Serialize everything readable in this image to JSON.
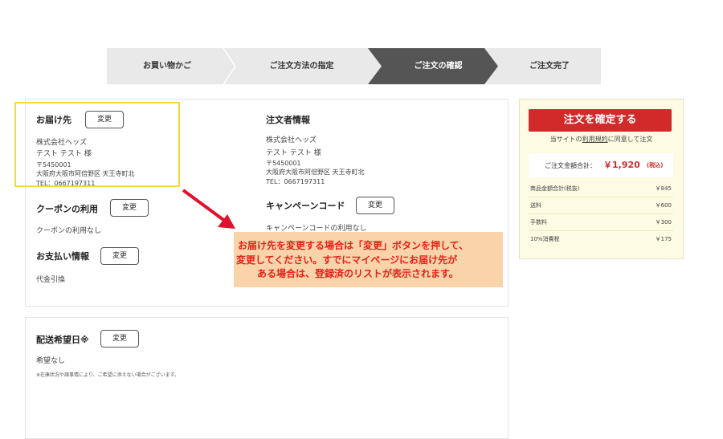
{
  "steps": [
    "お買い物かご",
    "ご注文方法の指定",
    "ご注文の確認",
    "ご注文完了"
  ],
  "shipping": {
    "title": "お届け先",
    "change": "変更",
    "company": "株式会社ヘッズ",
    "name": "テスト テスト 様",
    "postal": "〒5450001",
    "address": "大阪府大阪市阿倍野区 天王寺町北",
    "tel": "TEL：0667197311"
  },
  "orderer": {
    "title": "注文者情報",
    "company": "株式会社ヘッズ",
    "name": "テスト テスト 様",
    "postal": "〒5450001",
    "address": "大阪府大阪市阿倍野区 天王寺町北",
    "tel": "TEL：0667197311"
  },
  "coupon": {
    "title": "クーポンの利用",
    "change": "変更",
    "value": "クーポンの利用なし"
  },
  "campaign": {
    "title": "キャンペーンコード",
    "change": "変更",
    "value": "キャンペーンコードの利用なし"
  },
  "payment": {
    "title": "お支払い情報",
    "change": "変更",
    "value": "代金引換"
  },
  "delivery": {
    "title": "配送希望日※",
    "change": "変更",
    "value": "希望なし",
    "note": "※在庫状況や諸事情により、ご希望に添えない場合がございます。"
  },
  "summary": {
    "confirm_button": "注文を確定する",
    "agree_prefix": "当サイトの",
    "agree_link": "利用規約",
    "agree_suffix": "に同意して注文",
    "total_label": "ご注文金額合計：",
    "total_value": "￥1,920",
    "total_tax": "(税込)",
    "rows": [
      {
        "label": "商品金額合計(税抜)",
        "value": "￥845"
      },
      {
        "label": "送料",
        "value": "￥600"
      },
      {
        "label": "手数料",
        "value": "￥300"
      },
      {
        "label": "10%消費税",
        "value": "￥175"
      }
    ]
  },
  "callout": {
    "line1": "お届け先を変更する場合は「変更」ボタンを押して、",
    "line2": "変更してください。すでにマイページにお届け先が",
    "line3": "ある場合は、登録済のリストが表示されます。"
  },
  "colors": {
    "accent_red": "#d2292b",
    "callout_text": "#e2231a",
    "callout_bg": "#f9d3a9",
    "highlight": "#f2dc3e",
    "active_step": "#555555"
  }
}
